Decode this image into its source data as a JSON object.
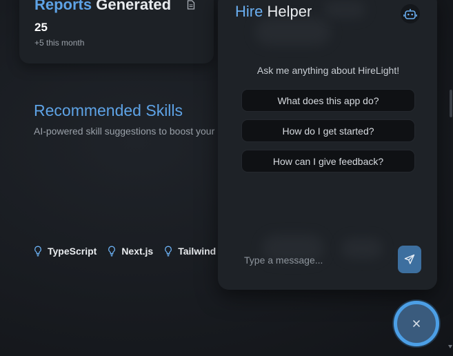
{
  "stats": {
    "title_part1": "Reports",
    "title_part2": "Generated",
    "value": "25",
    "change": "+5 this month",
    "icon": "document-icon"
  },
  "recommended": {
    "title": "Recommended Skills",
    "subtitle": "AI-powered skill suggestions to boost your career",
    "skills": [
      {
        "label": "TypeScript",
        "icon": "lightbulb-icon"
      },
      {
        "label": "Next.js",
        "icon": "lightbulb-icon"
      },
      {
        "label": "Tailwind",
        "icon": "lightbulb-icon"
      }
    ]
  },
  "chat": {
    "title_part1": "Hire",
    "title_part2": "Helper",
    "bot_icon": "bot-icon",
    "intro": "Ask me anything about HireLight!",
    "suggestions": [
      "What does this app do?",
      "How do I get started?",
      "How can I give feedback?"
    ],
    "input_placeholder": "Type a message...",
    "send_icon": "send-icon"
  },
  "fab": {
    "icon": "close-icon"
  },
  "colors": {
    "accent": "#5ea3e6",
    "fab_ring": "#4c9fe6",
    "send_button": "#3d6f9f",
    "panel": "#1e2227",
    "suggestion_bg": "#0f1114"
  }
}
